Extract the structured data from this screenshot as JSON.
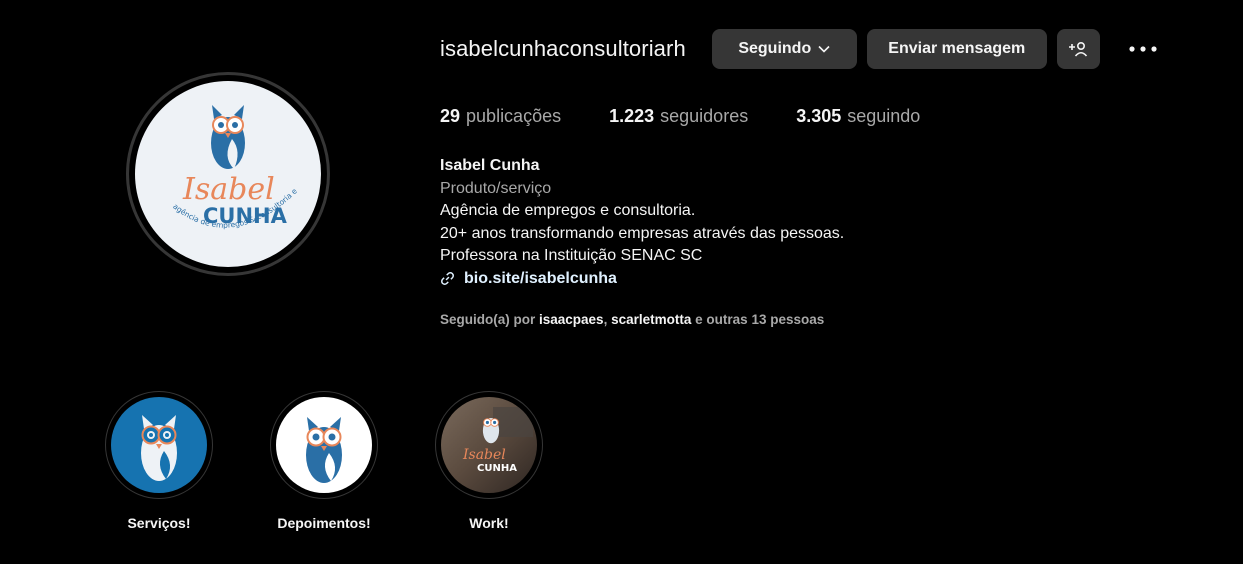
{
  "profile": {
    "username": "isabelcunhaconsultoriarh",
    "following_button": "Seguindo",
    "message_button": "Enviar mensagem",
    "avatar_logo": {
      "script_text": "Isabel",
      "block_text": "CUNHA",
      "tagline": "agência de empregos & consultoria em RH"
    }
  },
  "stats": [
    {
      "count": "29",
      "label": "publicações"
    },
    {
      "count": "1.223",
      "label": "seguidores"
    },
    {
      "count": "3.305",
      "label": "seguindo"
    }
  ],
  "bio": {
    "name": "Isabel Cunha",
    "category": "Produto/serviço",
    "lines": [
      "Agência de empregos e consultoria.",
      "20+ anos transformando empresas através das pessoas.",
      "Professora na Instituição SENAC SC"
    ],
    "link": "bio.site/isabelcunha"
  },
  "followed_by": {
    "prefix": "Seguido(a) por",
    "accounts": [
      "isaacpaes",
      "scarletmotta"
    ],
    "separator": ",",
    "suffix": "e outras 13 pessoas"
  },
  "highlights": [
    {
      "label": "Serviços!"
    },
    {
      "label": "Depoimentos!"
    },
    {
      "label": "Work!",
      "logo_script": "Isabel",
      "logo_block": "CUNHA"
    }
  ],
  "colors": {
    "background": "#000000",
    "button": "#363636",
    "muted_text": "#a8a8a8",
    "brand_blue": "#2a6fa6",
    "brand_orange": "#e8875a",
    "link": "#e0f1ff"
  }
}
